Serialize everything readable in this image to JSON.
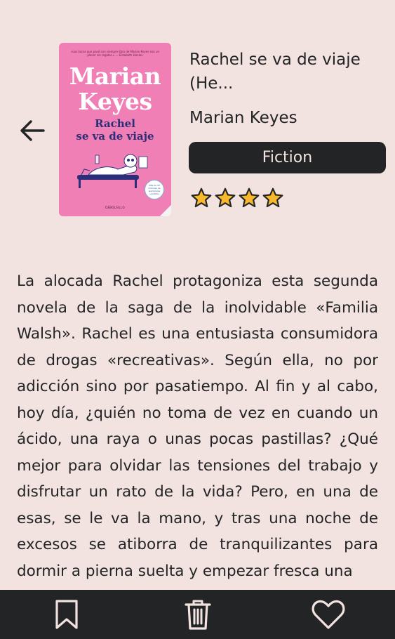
{
  "book": {
    "title": "Rachel se va de viaje (He...",
    "author": "Marian Keyes",
    "genre": "Fiction",
    "rating": 4,
    "rating_max": 4,
    "description": "La alocada Rachel protagoniza esta segunda novela de la saga de la inolvidable «Familia Walsh». Rachel es una entusiasta consumidora de drogas «recreativas». Según ella, no por adicción sino por pasatiempo. Al fin y al cabo, hoy día, ¿quién no toma de vez en cuando un ácido, una raya o unas pocas pastillas? ¿Qué mejor para olvidar las tensiones del trabajo y disfrutar un rato de la vida? Pero, en una de esas, se le va la mano, y tras una noche de excesos se atiborra de tranquilizantes para dormir a pierna suelta y empezar fresca una"
  },
  "cover": {
    "tagline": "«Las horas que pasé con siempre libro de Marian Keyes son un placer sin regalos.» — Elizabeth Hanlon",
    "author_line1": "Marian",
    "author_line2": "Keyes",
    "title_line1": "Rachel",
    "title_line2": "se va de viaje",
    "badge": "Más de 30 millones de ejemplares vendidos",
    "publisher": "DEBOLSILLO"
  },
  "icons": {
    "back": "arrow-left-icon",
    "star": "star-icon",
    "bookmark": "bookmark-icon",
    "delete": "trash-icon",
    "favorite": "heart-icon"
  },
  "colors": {
    "background": "#f3e3e0",
    "dark": "#222426",
    "cover_pink": "#ef7fb5",
    "star_fill": "#f7b92b"
  }
}
